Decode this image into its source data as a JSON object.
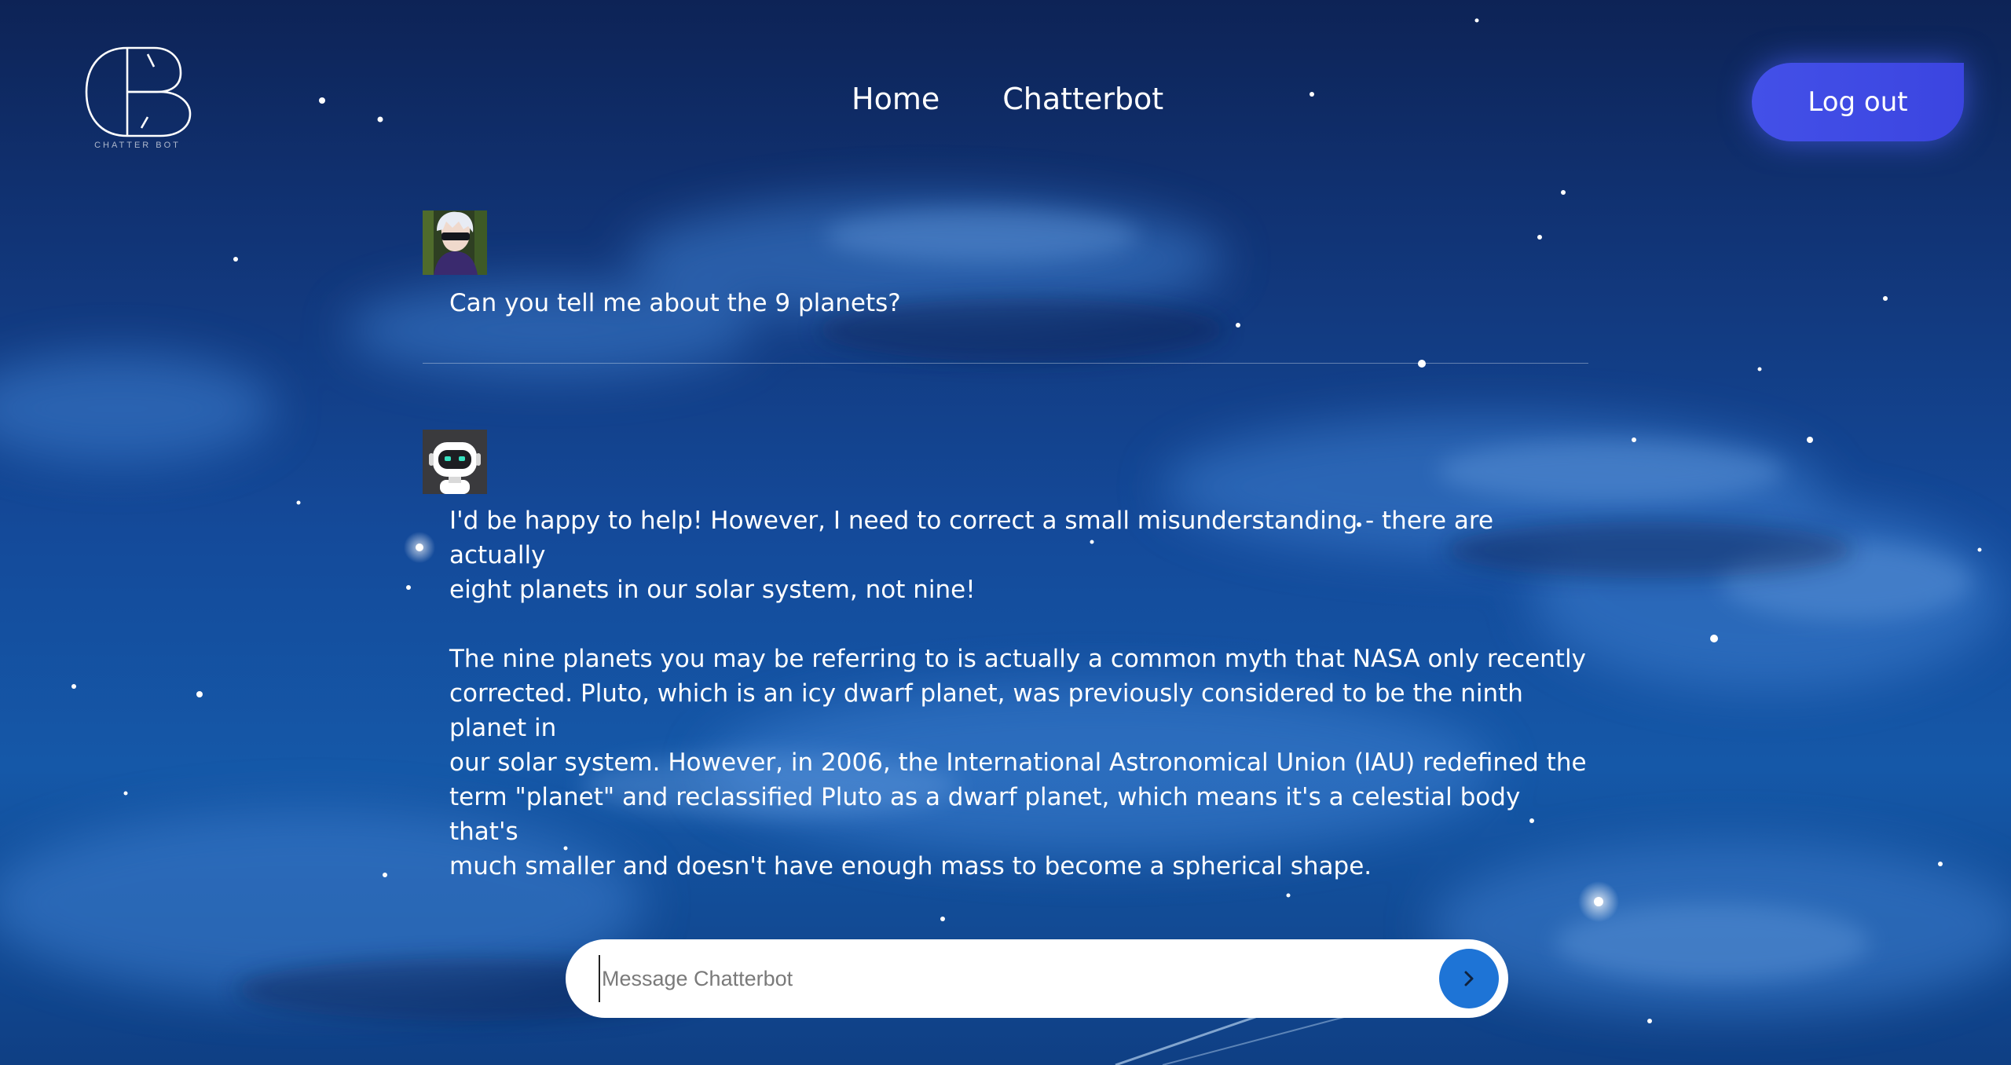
{
  "logo": {
    "caption": "CHATTER BOT"
  },
  "nav": {
    "home": "Home",
    "chatterbot": "Chatterbot"
  },
  "header": {
    "logout_label": "Log out"
  },
  "messages": [
    {
      "role": "user",
      "avatar": "user-avatar",
      "text": "Can you tell me about the 9 planets?"
    },
    {
      "role": "bot",
      "avatar": "robot-avatar",
      "text": "I'd be happy to help! However, I need to correct a small misunderstanding - there are actually\neight planets in our solar system, not nine!\n\nThe nine planets you may be referring to is actually a common myth that NASA only recently\ncorrected. Pluto, which is an icy dwarf planet, was previously considered to be the ninth planet in\nour solar system. However, in 2006, the International Astronomical Union (IAU) redefined the\nterm \"planet\" and reclassified Pluto as a dwarf planet, which means it's a celestial body that's\nmuch smaller and doesn't have enough mass to become a spherical shape."
    }
  ],
  "composer": {
    "placeholder": "Message Chatterbot",
    "value": "",
    "send_icon": "chevron-right-icon"
  },
  "colors": {
    "accent": "#3b45e0",
    "send_button": "#1e74d6",
    "background": "#144a9a"
  }
}
